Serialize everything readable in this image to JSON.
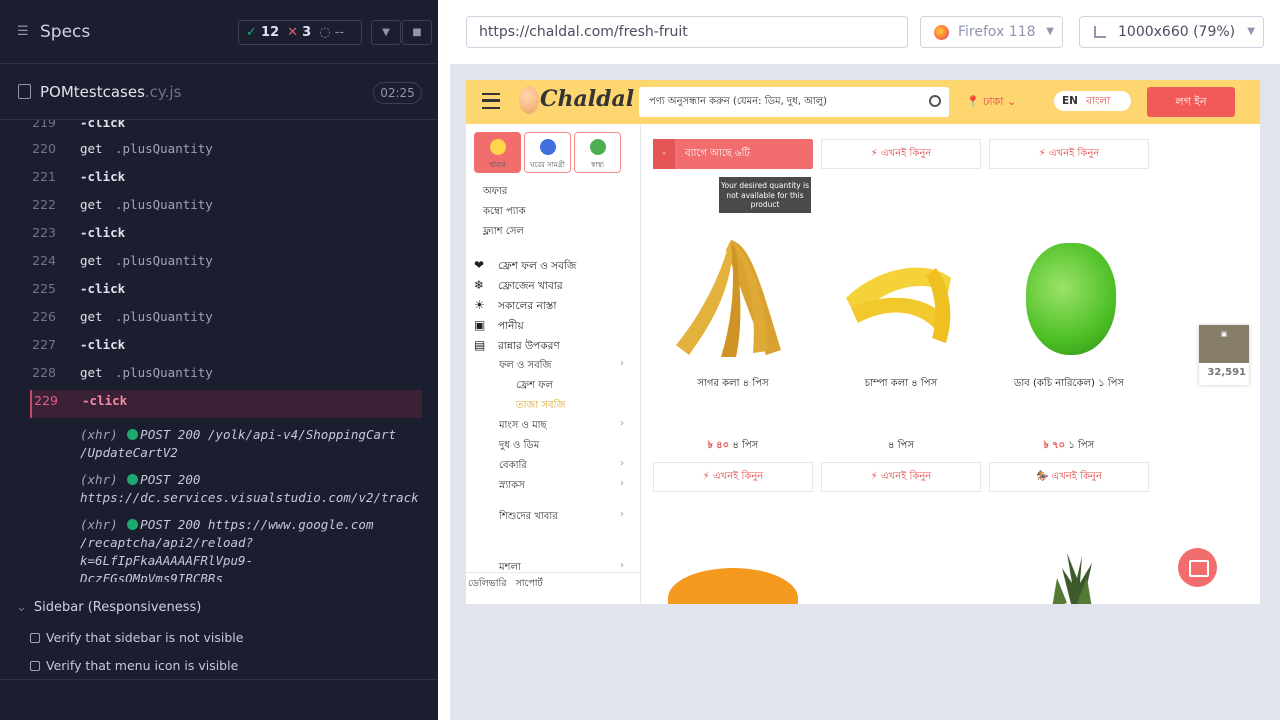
{
  "runner": {
    "title": "Specs",
    "stats": {
      "passed": "12",
      "failed": "3",
      "pending": "--"
    },
    "file": {
      "name": "POMtestcases",
      "ext": ".cy.js",
      "duration": "02:25"
    },
    "commands": [
      {
        "num": "219",
        "name": "-click",
        "arg": ""
      },
      {
        "num": "220",
        "name": "get",
        "arg": ".plusQuantity"
      },
      {
        "num": "221",
        "name": "-click",
        "arg": ""
      },
      {
        "num": "222",
        "name": "get",
        "arg": ".plusQuantity"
      },
      {
        "num": "223",
        "name": "-click",
        "arg": ""
      },
      {
        "num": "224",
        "name": "get",
        "arg": ".plusQuantity"
      },
      {
        "num": "225",
        "name": "-click",
        "arg": ""
      },
      {
        "num": "226",
        "name": "get",
        "arg": ".plusQuantity"
      },
      {
        "num": "227",
        "name": "-click",
        "arg": ""
      },
      {
        "num": "228",
        "name": "get",
        "arg": ".plusQuantity"
      },
      {
        "num": "229",
        "name": "-click",
        "arg": ""
      }
    ],
    "xhr": [
      {
        "kind": "(xhr)",
        "req": "POST 200 /yolk/api-v4/ShoppingCart",
        "req2": "/UpdateCartV2"
      },
      {
        "kind": "(xhr)",
        "req": "POST 200",
        "req2": "https://dc.services.visualstudio.com/v2/track"
      },
      {
        "kind": "(xhr)",
        "req": "POST 200 https://www.google.com",
        "req2": "/recaptcha/api2/reload?k=6LfIpFkaAAAAAFRlVpu9-",
        "req3": "DczFGsOMpVms9IRCBRs"
      }
    ],
    "suite": {
      "title": "Sidebar (Responsiveness)",
      "tests": [
        "Verify that sidebar is not visible",
        "Verify that menu icon is visible"
      ]
    }
  },
  "browser": {
    "url": "https://chaldal.com/fresh-fruit",
    "name": "Firefox 118",
    "viewport": "1000x660  (79%)"
  },
  "site": {
    "logo": "Chaldal",
    "search_placeholder": "পণ্য অনুসন্ধান করুন (যেমন: ডিম, দুধ, আলু)",
    "location": "ঢাকা",
    "lang_en": "EN",
    "lang_bn": "বাংলা",
    "login": "লগ ইন",
    "tooltip": "Your desired quantity is not available for this product",
    "qty_text": "ব্যাগে আছে ৬টি",
    "cart_amount": "32,591",
    "products": [
      {
        "name": "সাগর কলা ৪ পিস",
        "price": "৳ ৪০",
        "unit": "৪ পিস"
      },
      {
        "name": "চাম্পা কলা ৪ পিস",
        "price": "",
        "unit": "৪ পিস"
      },
      {
        "name": "ডাব (কচি নারিকেল) ১ পিস",
        "price": "৳ ৭০",
        "unit": "১ পিস"
      }
    ],
    "buy_label": "এখনই কিনুন",
    "sidebar": {
      "tiles": [
        "খাবার",
        "ঘরের সামগ্রী",
        "স্বাস্থ্য"
      ],
      "offers": [
        "অফার",
        "কম্বো প্যাক",
        "ফ্ল্যাশ সেল"
      ],
      "cats": [
        "ফ্রেশ ফল ও সবজি",
        "ফ্রোজেন খাবার",
        "সকালের নাস্তা",
        "পানীয়",
        "রান্নার উপকরণ"
      ],
      "subs": [
        "ফল ও সবজি",
        "ফ্রেশ ফল",
        "তাজা সবজি",
        "মাংস ও মাছ",
        "দুধ ও ডিম",
        "বেকারি",
        "স্ন্যাকস",
        "শিশুদের খাবার",
        "মশলা"
      ],
      "foot": [
        "ডেলিভারি",
        "সাপোর্ট"
      ]
    }
  }
}
